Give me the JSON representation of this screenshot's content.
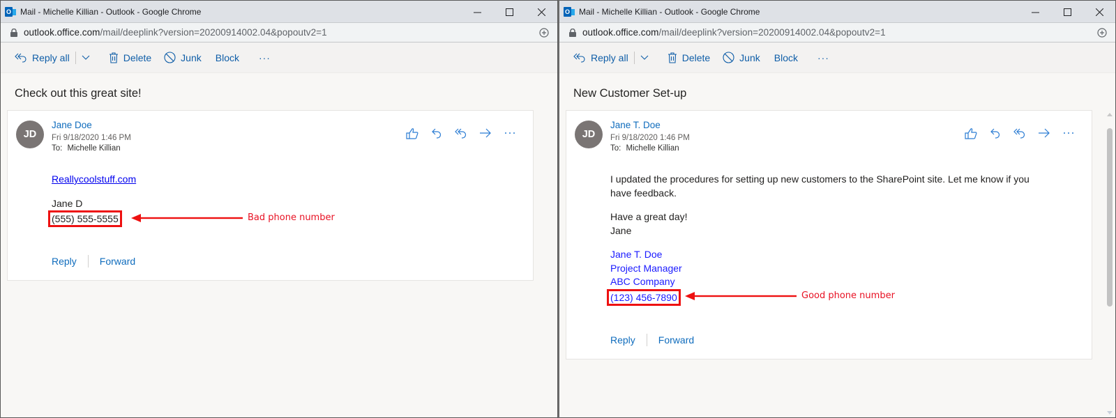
{
  "windows": [
    {
      "title": "Mail - Michelle Killian - Outlook - Google Chrome",
      "url_host": "outlook.office.com",
      "url_path": "/mail/deeplink?version=20200914002.04&popoutv2=1",
      "toolbar": {
        "reply_all": "Reply all",
        "delete": "Delete",
        "junk": "Junk",
        "block": "Block",
        "more": "···"
      },
      "subject": "Check out this great site!",
      "message": {
        "avatar_initials": "JD",
        "sender": "Jane Doe",
        "date": "Fri 9/18/2020 1:46 PM",
        "to_label": "To:",
        "to": "Michelle Killian",
        "link": "Reallycoolstuff.com",
        "signature_name": "Jane D",
        "phone": "(555) 555-5555",
        "reply": "Reply",
        "forward": "Forward"
      },
      "annotation": {
        "text": "Bad phone number",
        "color": "#e81123"
      }
    },
    {
      "title": "Mail - Michelle Killian - Outlook - Google Chrome",
      "url_host": "outlook.office.com",
      "url_path": "/mail/deeplink?version=20200914002.04&popoutv2=1",
      "toolbar": {
        "reply_all": "Reply all",
        "delete": "Delete",
        "junk": "Junk",
        "block": "Block",
        "more": "···"
      },
      "subject": "New Customer Set-up",
      "message": {
        "avatar_initials": "JD",
        "sender": "Jane T. Doe",
        "date": "Fri 9/18/2020 1:46 PM",
        "to_label": "To:",
        "to": "Michelle Killian",
        "body_line1": "I updated the procedures for setting up new customers to the SharePoint site. Let me know if you",
        "body_line2": "have feedback.",
        "greeting": "Have a great day!",
        "closing_name": "Jane",
        "sig_name": "Jane T. Doe",
        "sig_title": "Project Manager",
        "sig_company": "ABC Company",
        "phone": "(123) 456-7890",
        "reply": "Reply",
        "forward": "Forward"
      },
      "annotation": {
        "text": "Good phone number",
        "color": "#e81123"
      }
    }
  ],
  "colors": {
    "accent": "#0f6cbd",
    "annotation_red": "#e81123",
    "avatar_bg": "#7a7574"
  }
}
